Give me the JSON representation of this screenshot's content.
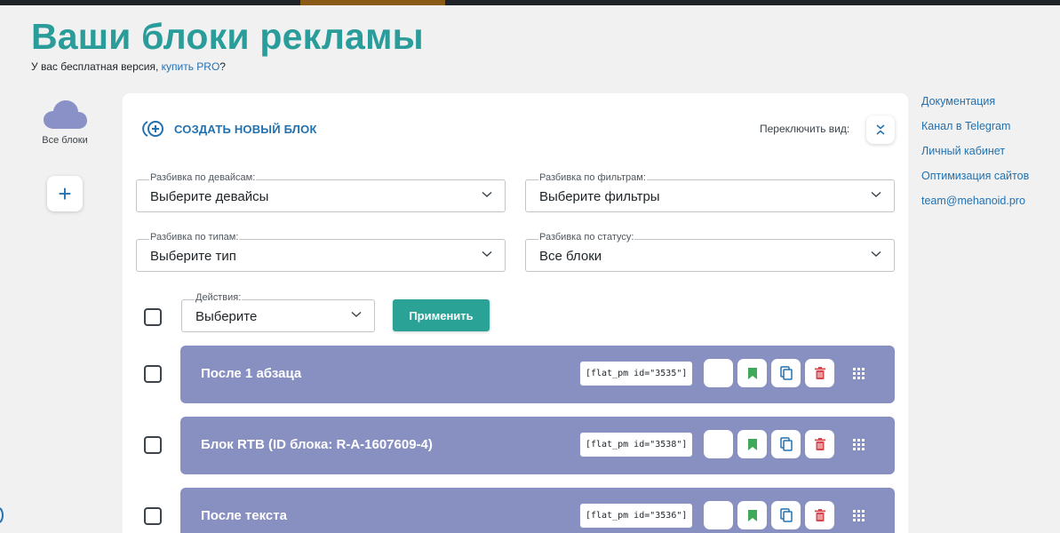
{
  "header": {
    "title": "Ваши блоки рекламы",
    "subtitle_prefix": "У вас бесплатная версия, ",
    "subtitle_link": "купить PRO",
    "subtitle_suffix": "?"
  },
  "sidebar": {
    "all_blocks_label": "Все блоки",
    "add_label": "+"
  },
  "toolbar": {
    "create_label": "СОЗДАТЬ НОВЫЙ БЛОК",
    "switch_view_label": "Переключить вид:"
  },
  "filters": {
    "devices": {
      "label": "Разбивка по девайсам:",
      "value": "Выберите девайсы"
    },
    "filters": {
      "label": "Разбивка по фильтрам:",
      "value": "Выберите фильтры"
    },
    "types": {
      "label": "Разбивка по типам:",
      "value": "Выберите тип"
    },
    "status": {
      "label": "Разбивка по статусу:",
      "value": "Все блоки"
    }
  },
  "actions": {
    "label": "Действия:",
    "value": "Выберите",
    "apply_label": "Применить"
  },
  "blocks": [
    {
      "name": "После 1 абзаца",
      "shortcode": "[flat_pm id=\"3535\"]"
    },
    {
      "name": "Блок RTB (ID блока: R-A-1607609-4)",
      "shortcode": "[flat_pm id=\"3538\"]"
    },
    {
      "name": "После текста",
      "shortcode": "[flat_pm id=\"3536\"]"
    }
  ],
  "links": [
    "Документация",
    "Канал в Telegram",
    "Личный кабинет",
    "Оптимизация сайтов",
    "team@mehanoid.pro"
  ],
  "colors": {
    "accent_title": "#2a9d9b",
    "link": "#2271b1",
    "block_bg": "#8890c2",
    "apply_bg": "#2aa396",
    "bookmark_green": "#3fa85a",
    "delete_red": "#d9474f"
  },
  "icons": {
    "cloud": "cloud-icon",
    "plus": "plus-icon",
    "create": "add-circle-icon",
    "switch": "collapse-icon",
    "chevron": "chevron-down-icon",
    "bookmark": "bookmark-icon",
    "copy": "copy-icon",
    "delete": "trash-icon",
    "drag": "drag-grid-icon"
  }
}
